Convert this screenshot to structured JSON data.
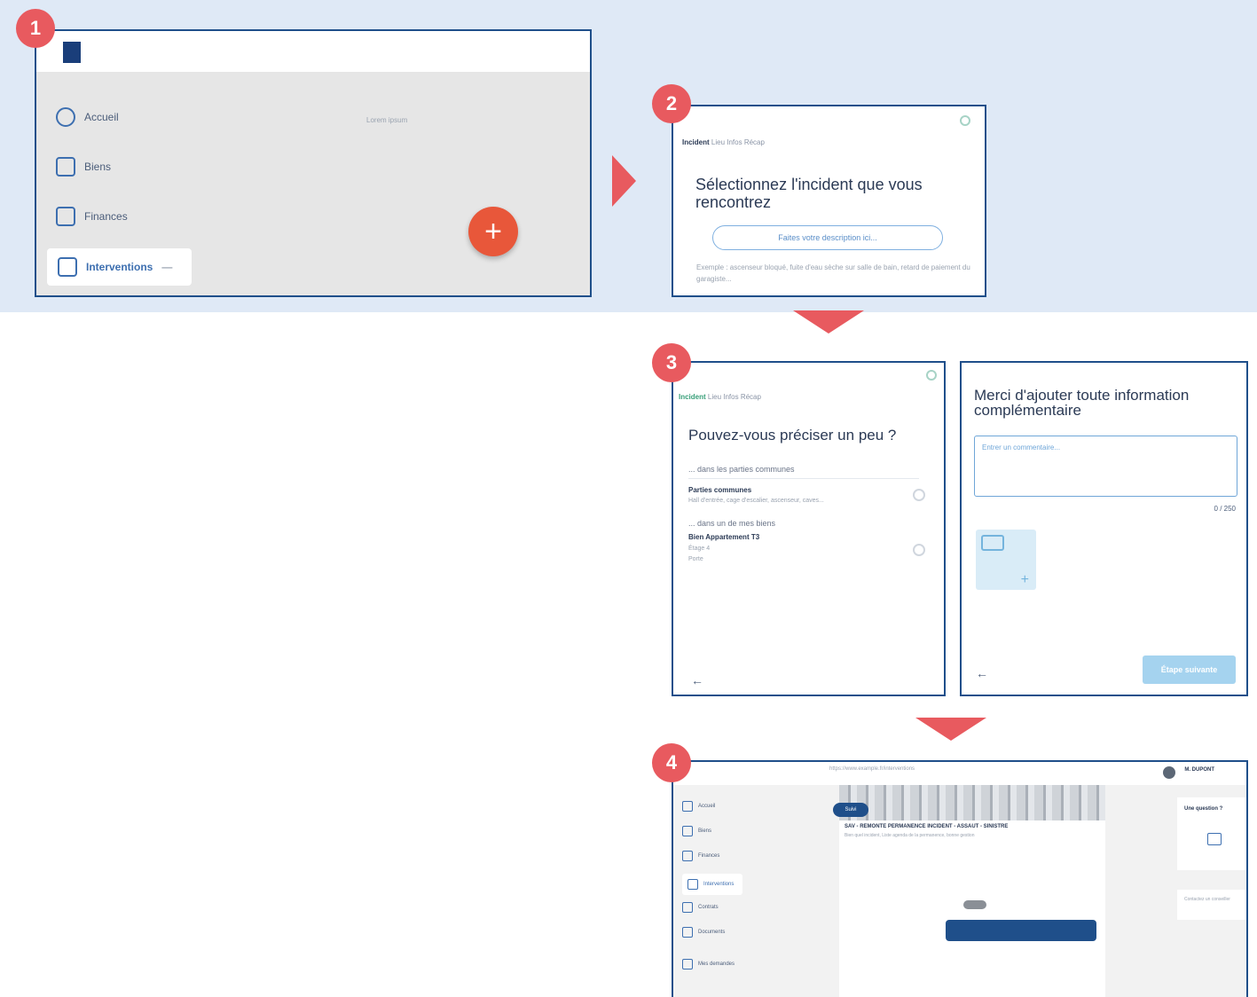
{
  "steps": [
    "1",
    "2",
    "3",
    "4"
  ],
  "colors": {
    "band": "#dfe9f6",
    "frame": "#1f4f8a",
    "accent": "#e85a5f",
    "fab": "#e8573a"
  },
  "screen1": {
    "nav": [
      {
        "label": "Accueil",
        "icon": "pie-chart-icon"
      },
      {
        "label": "Biens",
        "icon": "building-icon"
      },
      {
        "label": "Finances",
        "icon": "wallet-icon"
      },
      {
        "label": "Interventions",
        "icon": "tools-icon",
        "active": true
      }
    ],
    "hint": "Lorem ipsum",
    "fab_label": "+"
  },
  "screen2": {
    "breadcrumb_bold": "Incident",
    "breadcrumb_rest": "Lieu Infos Récap",
    "title": "Sélectionnez l'incident que vous rencontrez",
    "search_button": "Faites votre description ici...",
    "example": "Exemple : ascenseur bloqué, fuite d'eau sèche sur salle de bain, retard de paiement du garagiste..."
  },
  "screen3a": {
    "breadcrumb_bold": "Incident",
    "breadcrumb_rest": "Lieu Infos Récap",
    "title": "Pouvez-vous préciser un peu ?",
    "section1": "... dans les parties communes",
    "option1_title": "Parties communes",
    "option1_sub": "Hall d'entrée, cage d'escalier, ascenseur, caves...",
    "section2": "... dans un de mes biens",
    "option2_title": "Bien Appartement T3",
    "option2_sub1": "Étage 4",
    "option2_sub2": "Porte",
    "back": "←"
  },
  "screen3b": {
    "title": "Merci d'ajouter toute information complémentaire",
    "comment_placeholder": "Entrer un commentaire...",
    "counter": "0 / 250",
    "submit": "Étape suivante",
    "back": "←"
  },
  "screen4": {
    "url": "https://www.example.fr/interventions",
    "user_name": "M. DUPONT",
    "nav": [
      "Accueil",
      "Biens",
      "Finances",
      "Interventions",
      "Contrats",
      "Documents",
      "Mes demandes"
    ],
    "pill": "Suivi",
    "message_title": "SAV - REMONTE PERMANENCE INCIDENT - ASSAUT - SINISTRE",
    "message_sub": "Bien quel incident, Liste agenda de la permanence, bonne gestion",
    "side_title": "Une question ?",
    "side_note": "Contactez un conseiller"
  }
}
